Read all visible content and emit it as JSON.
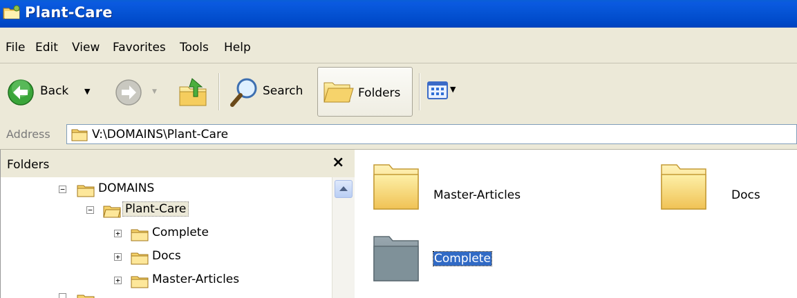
{
  "window": {
    "title": "Plant-Care"
  },
  "menu": [
    "File",
    "Edit",
    "View",
    "Favorites",
    "Tools",
    "Help"
  ],
  "toolbar": {
    "back_label": "Back",
    "search_label": "Search",
    "folders_label": "Folders"
  },
  "address": {
    "label": "Address",
    "value": "V:\\DOMAINS\\Plant-Care"
  },
  "folders_pane": {
    "title": "Folders",
    "close": "×",
    "tree": [
      {
        "label": "DOMAINS",
        "expander": "−"
      },
      {
        "label": "Plant-Care",
        "expander": "−",
        "selected": true
      },
      {
        "label": "Complete",
        "expander": "+"
      },
      {
        "label": "Docs",
        "expander": "+"
      },
      {
        "label": "Master-Articles",
        "expander": "+"
      }
    ]
  },
  "content": {
    "items": [
      {
        "label": "Master-Articles",
        "selected": false
      },
      {
        "label": "Docs",
        "selected": false
      },
      {
        "label": "Complete",
        "selected": true
      }
    ]
  },
  "colors": {
    "title_bar": "#0553d4",
    "chrome": "#ece9d8",
    "selection": "#316ac5",
    "folder_yellow": "#f6d36b"
  }
}
